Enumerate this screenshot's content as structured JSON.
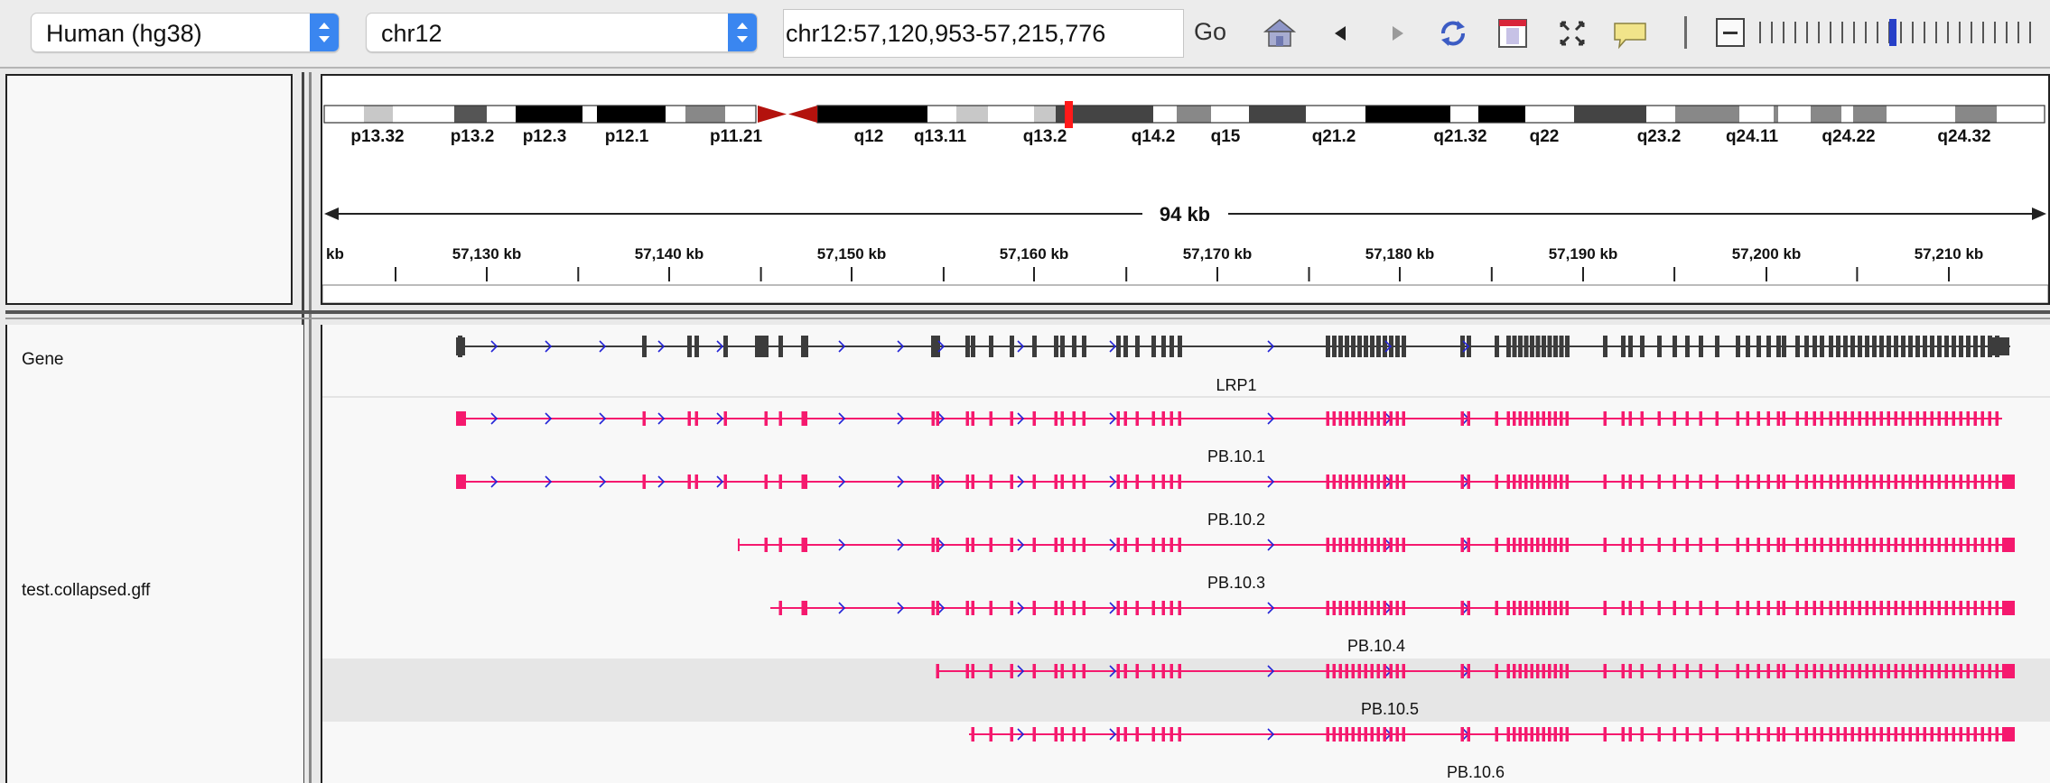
{
  "toolbar": {
    "genome": "Human (hg38)",
    "chromosome": "chr12",
    "locus": "chr12:57,120,953-57,215,776",
    "go_label": "Go"
  },
  "ideogram": {
    "bands": [
      "p13.32",
      "p13.2",
      "p12.3",
      "p12.1",
      "p11.21",
      "q12",
      "q13.11",
      "q13.2",
      "q14.2",
      "q15",
      "q21.2",
      "q21.32",
      "q22",
      "q23.2",
      "q24.11",
      "q24.22",
      "q24.32"
    ]
  },
  "ruler": {
    "span_label": "94 kb",
    "first_label": "kb",
    "ticks": [
      "57,130 kb",
      "57,140 kb",
      "57,150 kb",
      "57,160 kb",
      "57,170 kb",
      "57,180 kb",
      "57,190 kb",
      "57,200 kb",
      "57,210 kb"
    ]
  },
  "tracks": {
    "gene_track_name": "Gene",
    "gene_name": "LRP1",
    "feature_track_name": "test.collapsed.gff",
    "transcripts": [
      "PB.10.1",
      "PB.10.2",
      "PB.10.3",
      "PB.10.4",
      "PB.10.5",
      "PB.10.6"
    ]
  },
  "colors": {
    "transcript": "#f5196e",
    "strand_arrow": "#2323d6",
    "gene": "#3c3c3c",
    "current_band": "#ff1a1a"
  }
}
